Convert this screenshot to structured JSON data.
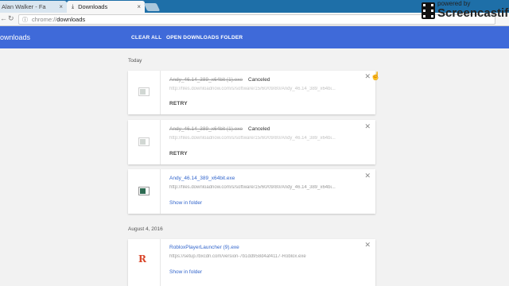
{
  "tabs": [
    {
      "label": "Alan Walker - Fa",
      "close": "×"
    },
    {
      "label": "Downloads",
      "close": "×"
    }
  ],
  "address": {
    "scheme": "chrome://",
    "path": "downloads"
  },
  "header": {
    "title": "ownloads",
    "clear_all": "CLEAR ALL",
    "open_folder": "OPEN DOWNLOADS FOLDER"
  },
  "watermark": {
    "powered": "powered by",
    "brand": "Screencastify L"
  },
  "groups": [
    {
      "date": "Today"
    },
    {
      "date": "August 4, 2016"
    }
  ],
  "downloads": [
    {
      "name": "Andy_46.14_389_x64bit (1).exe",
      "status": "Canceled",
      "url": "http://files.downloadnow.com/s/software/15/60/09/80/Andy_46.14_389_x64bi...",
      "action": "RETRY"
    },
    {
      "name": "Andy_46.14_389_x64bit (1).exe",
      "status": "Canceled",
      "url": "http://files.downloadnow.com/s/software/15/60/09/80/Andy_46.14_389_x64bi...",
      "action": "RETRY"
    },
    {
      "name": "Andy_46.14_389_x64bit.exe",
      "status": "",
      "url": "http://files.downloadnow.com/s/software/15/60/09/80/Andy_46.14_389_x64bi...",
      "action": "Show in folder"
    },
    {
      "name": "RobloxPlayerLauncher (9).exe",
      "status": "",
      "url": "https://setup.rbxcdn.com/version-7b1dd958d4af4117-Roblox.exe",
      "action": "Show in folder"
    }
  ],
  "icons": {
    "back": "back-arrow-icon",
    "reload": "reload-icon",
    "info": "info-icon",
    "close": "close-icon",
    "file": "file-icon",
    "roblox": "roblox-icon"
  },
  "colors": {
    "header": "#3f6ad9",
    "tabbar": "#1e6fa8",
    "link": "#3366cc"
  }
}
